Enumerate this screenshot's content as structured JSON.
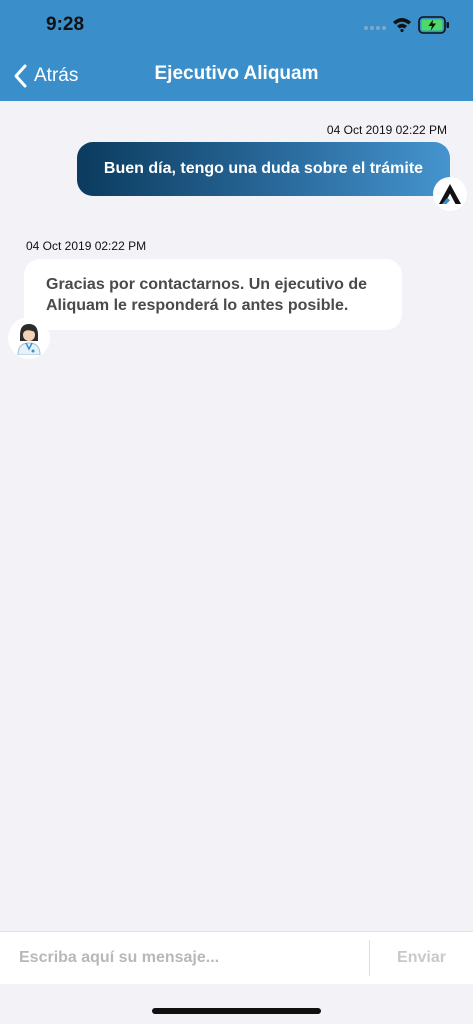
{
  "status_bar": {
    "time": "9:28"
  },
  "nav": {
    "back_label": "Atrás",
    "title": "Ejecutivo Aliquam"
  },
  "messages": [
    {
      "direction": "outgoing",
      "timestamp": "04 Oct 2019 02:22 PM",
      "text": "Buen día, tengo una duda sobre el trámite",
      "avatar": "company-logo-icon"
    },
    {
      "direction": "incoming",
      "timestamp": "04 Oct 2019 02:22 PM",
      "text": "Gracias por contactarnos. Un ejecutivo de Aliquam le responderá lo antes posible.",
      "avatar": "agent-avatar-icon"
    }
  ],
  "composer": {
    "value": "",
    "placeholder": "Escriba aquí su mensaje...",
    "send_label": "Enviar"
  },
  "colors": {
    "header": "#3a8fcb",
    "background": "#f2f2f7",
    "outgoing_bubble_start": "#0b3b5e",
    "outgoing_bubble_end": "#4594cf",
    "incoming_bubble": "#ffffff",
    "battery": "#4cd964"
  }
}
